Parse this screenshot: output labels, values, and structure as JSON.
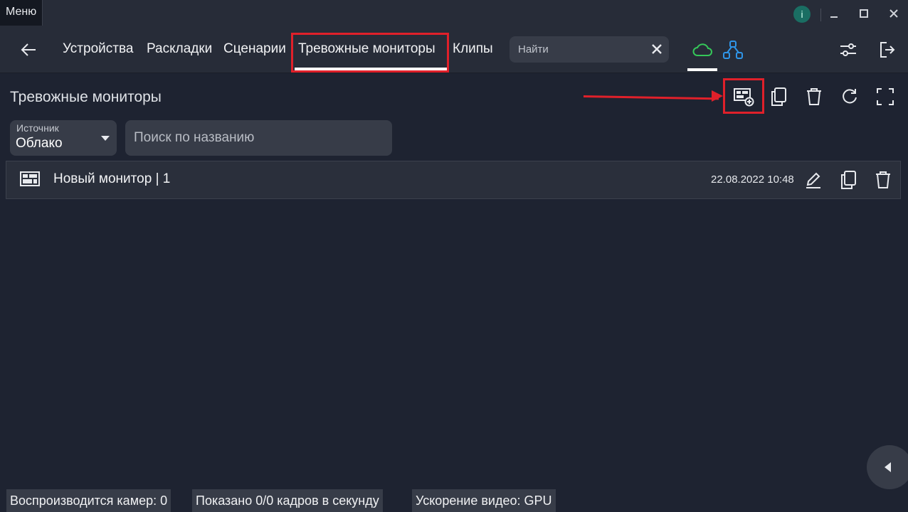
{
  "window": {
    "menu_label": "Меню",
    "info_label": "i"
  },
  "nav": {
    "tabs": [
      "Устройства",
      "Раскладки",
      "Сценарии",
      "Тревожные мониторы",
      "Клипы"
    ],
    "active_tab": "Тревожные мониторы",
    "search_placeholder": "Найти"
  },
  "page": {
    "title": "Тревожные мониторы"
  },
  "filters": {
    "source_label": "Источник",
    "source_value": "Облако",
    "name_search_placeholder": "Поиск по названию"
  },
  "monitors": [
    {
      "name": "Новый монитор  | 1",
      "date": "22.08.2022 10:48"
    }
  ],
  "status_bar": {
    "cameras": "Воспроизводится камер: 0",
    "frames": "Показано 0/0 кадров в секунду",
    "acceleration": "Ускорение видео: GPU"
  },
  "colors": {
    "background": "#1e2331",
    "panel": "#272c38",
    "highlight_red": "#e0202a",
    "cloud_green": "#35c759",
    "network_blue": "#2f95e8"
  }
}
